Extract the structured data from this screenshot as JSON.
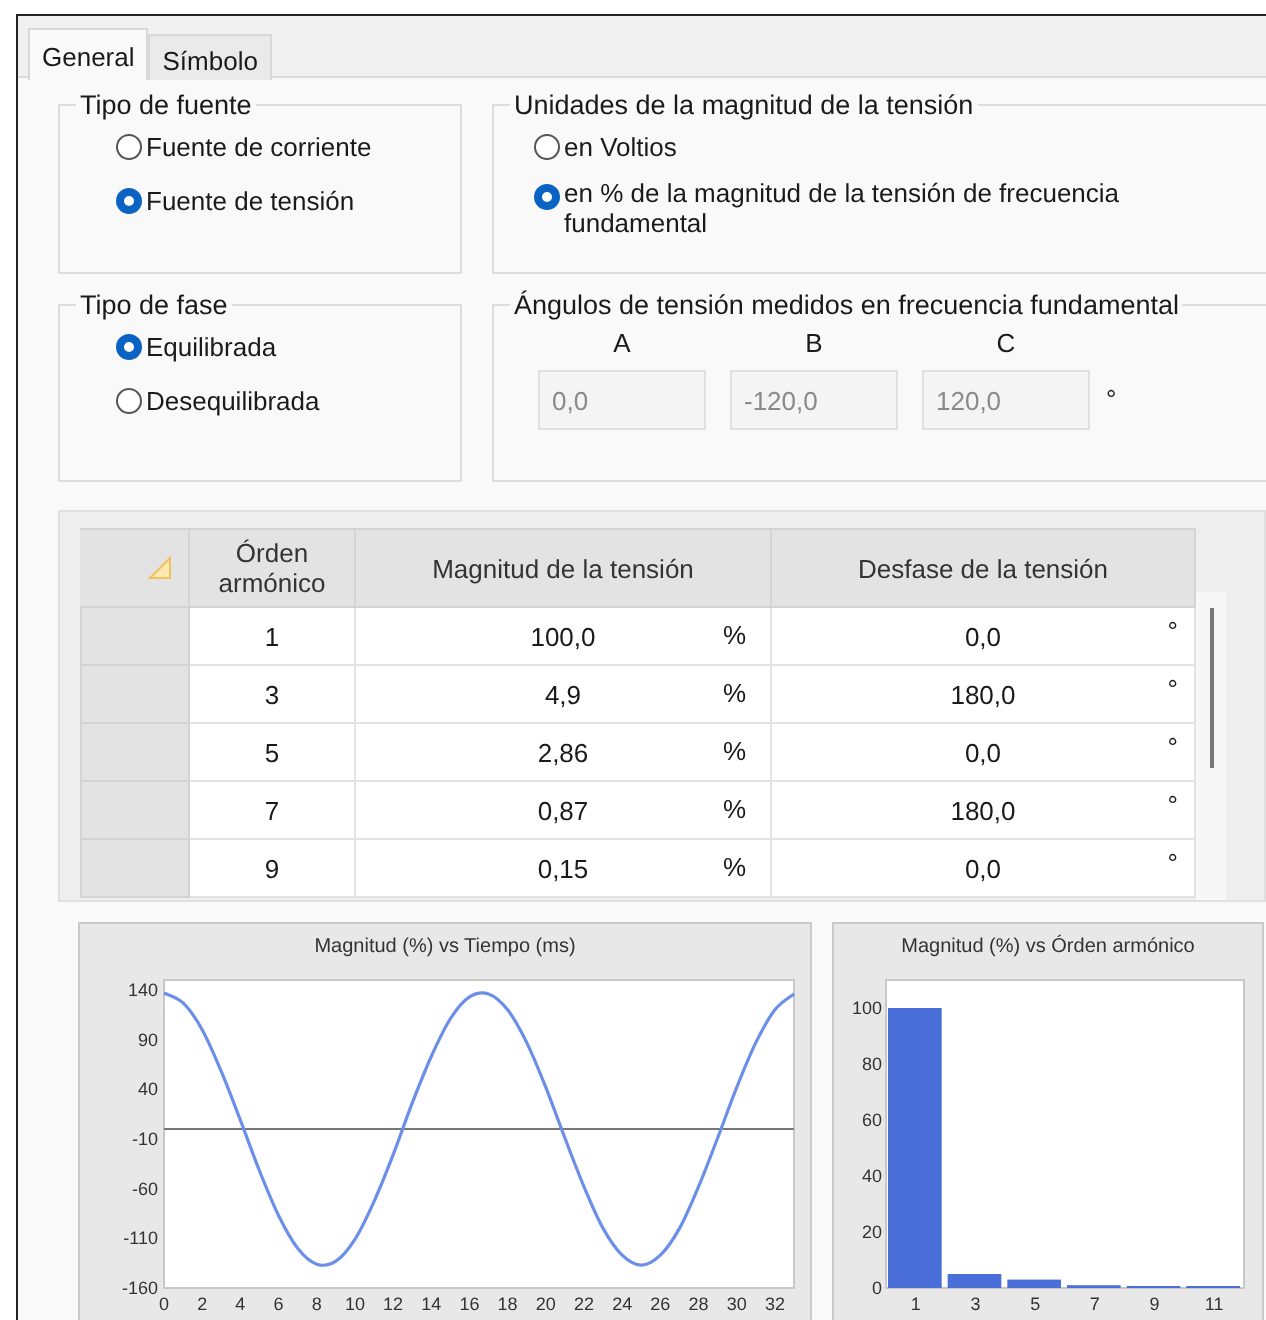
{
  "tabs": [
    {
      "label": "General",
      "selected": true
    },
    {
      "label": "Símbolo",
      "selected": false
    }
  ],
  "source_type": {
    "title": "Tipo de fuente",
    "options": [
      {
        "label": "Fuente de corriente",
        "selected": false
      },
      {
        "label": "Fuente de tensión",
        "selected": true
      }
    ]
  },
  "magnitude_units": {
    "title": "Unidades de la magnitud de la tensión",
    "options": [
      {
        "label": "en Voltios",
        "selected": false
      },
      {
        "label": "en % de la magnitud de la tensión de frecuencia fundamental",
        "selected": true
      }
    ]
  },
  "phase_type": {
    "title": "Tipo de fase",
    "options": [
      {
        "label": "Equilibrada",
        "selected": true
      },
      {
        "label": "Desequilibrada",
        "selected": false
      }
    ]
  },
  "angles": {
    "title": "Ángulos de tensión medidos en frecuencia fundamental",
    "unit": "°",
    "fields": [
      {
        "label": "A",
        "value": "0,0",
        "disabled": true
      },
      {
        "label": "B",
        "value": "-120,0",
        "disabled": true
      },
      {
        "label": "C",
        "value": "120,0",
        "disabled": true
      }
    ]
  },
  "table": {
    "columns": [
      "Órden armónico",
      "Magnitud de la tensión",
      "Desfase de la tensión"
    ],
    "rows": [
      {
        "order": "1",
        "magnitude": "100,0",
        "magnitude_unit": "%",
        "phase": "0,0",
        "phase_unit": "°"
      },
      {
        "order": "3",
        "magnitude": "4,9",
        "magnitude_unit": "%",
        "phase": "180,0",
        "phase_unit": "°"
      },
      {
        "order": "5",
        "magnitude": "2,86",
        "magnitude_unit": "%",
        "phase": "0,0",
        "phase_unit": "°"
      },
      {
        "order": "7",
        "magnitude": "0,87",
        "magnitude_unit": "%",
        "phase": "180,0",
        "phase_unit": "°"
      },
      {
        "order": "9",
        "magnitude": "0,15",
        "magnitude_unit": "%",
        "phase": "0,0",
        "phase_unit": "°"
      }
    ]
  },
  "time_chart": {
    "chart_data": {
      "type": "line",
      "title": "Magnitud (%) vs Tiempo (ms)",
      "x": [
        0,
        1,
        2,
        3,
        4,
        5,
        6,
        7,
        8,
        9,
        10,
        11,
        12,
        13,
        14,
        15,
        16,
        17,
        18,
        19,
        20,
        21,
        22,
        23,
        24,
        25,
        26,
        27,
        28,
        29,
        30,
        31,
        32,
        33
      ],
      "xlim": [
        0,
        33
      ],
      "ylim": [
        -160,
        150
      ],
      "xticks": [
        0,
        2,
        4,
        6,
        8,
        10,
        12,
        14,
        16,
        18,
        20,
        22,
        24,
        26,
        28,
        30,
        32
      ],
      "yticks": [
        140,
        90,
        40,
        -10,
        -60,
        -110,
        -160
      ],
      "series": [
        {
          "color": "#6b8fe8",
          "values": [
            137,
            127,
            100,
            58,
            9,
            -42,
            -87,
            -120,
            -136,
            -133,
            -111,
            -73,
            -26,
            26,
            73,
            111,
            133,
            136,
            120,
            87,
            42,
            -9,
            -58,
            -100,
            -127,
            -137,
            -127,
            -100,
            -58,
            -9,
            42,
            87,
            120,
            136
          ]
        }
      ]
    }
  },
  "spectrum_chart": {
    "chart_data": {
      "type": "bar",
      "title": "Magnitud (%) vs Órden armónico",
      "categories": [
        "1",
        "3",
        "5",
        "7",
        "9",
        "11"
      ],
      "ylim": [
        0,
        110
      ],
      "yticks": [
        0,
        20,
        40,
        60,
        80,
        100
      ],
      "series": [
        {
          "color": "#4a6fd8",
          "values": [
            100,
            5,
            3,
            1,
            0,
            0
          ]
        }
      ]
    }
  }
}
